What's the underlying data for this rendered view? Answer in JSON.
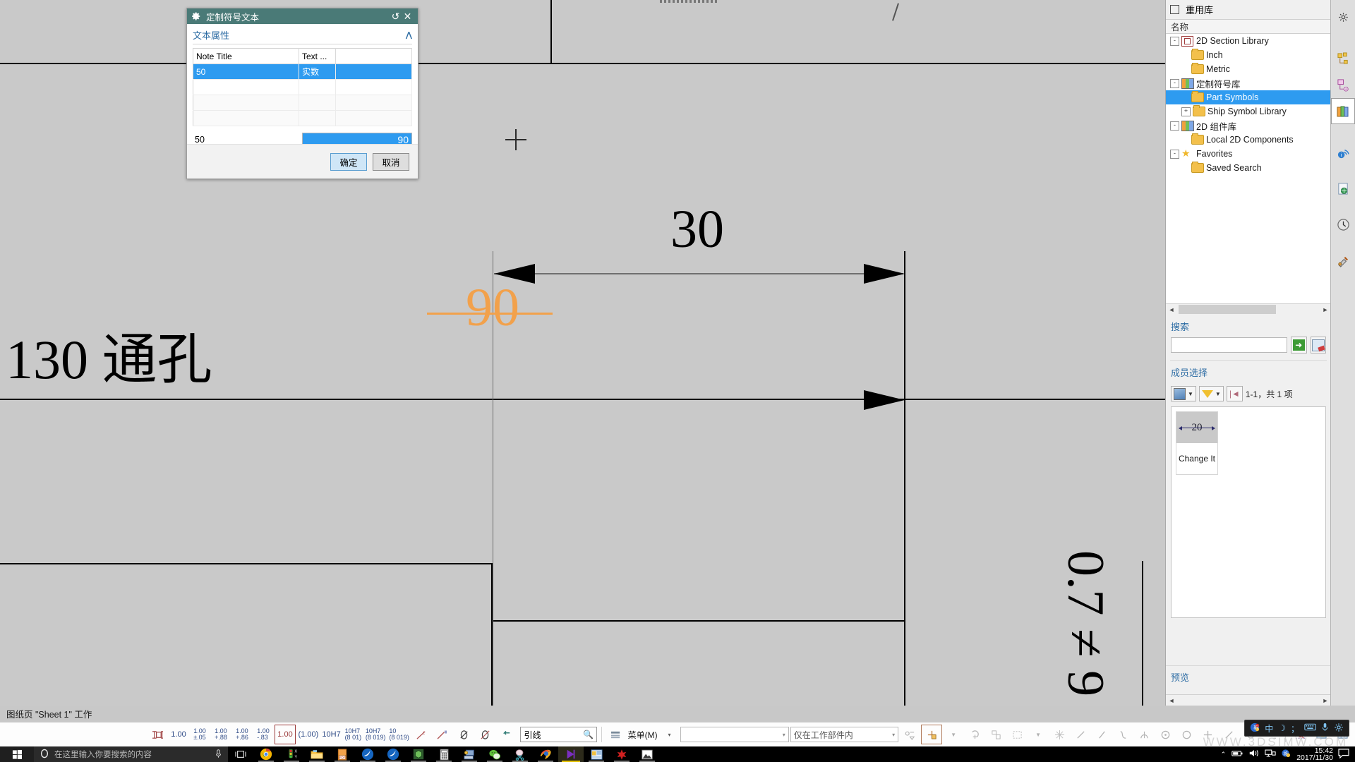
{
  "dialog": {
    "title": "定制符号文本",
    "gear_icon": "gear-icon",
    "reset_icon": "reset-icon",
    "close_icon": "close-icon",
    "section_title": "文本属性",
    "collapse_icon": "chevron-up-icon",
    "table": {
      "headers": [
        "Note Title",
        "Text ...",
        ""
      ],
      "rows": [
        {
          "note_title": "50",
          "text_type": "实数",
          "extra": "",
          "selected": true
        },
        {
          "note_title": "",
          "text_type": "",
          "extra": "",
          "selected": false
        },
        {
          "note_title": "",
          "text_type": "",
          "extra": "",
          "selected": false
        },
        {
          "note_title": "",
          "text_type": "",
          "extra": "",
          "selected": false
        }
      ]
    },
    "value_row": {
      "label": "50",
      "value": "90"
    },
    "ok_label": "确定",
    "cancel_label": "取消"
  },
  "canvas": {
    "dimension_30": "30",
    "orange_value": "90",
    "note_130": "130 通孔",
    "vertical_text": "0.7 ≠ 9",
    "crosshair": "crosshair-cursor"
  },
  "right_panel": {
    "title": "重用库",
    "title_icon": "panel-collapse-icon",
    "column_header": "名称",
    "tree": [
      {
        "label": "2D Section Library",
        "indent": 0,
        "expander": "-",
        "icon": "section-library-icon",
        "selected": false
      },
      {
        "label": "Inch",
        "indent": 1,
        "expander": "",
        "icon": "folder-icon",
        "selected": false
      },
      {
        "label": "Metric",
        "indent": 1,
        "expander": "",
        "icon": "folder-icon",
        "selected": false
      },
      {
        "label": "定制符号库",
        "indent": 0,
        "expander": "-",
        "icon": "books-icon",
        "selected": false
      },
      {
        "label": "Part Symbols",
        "indent": 1,
        "expander": "",
        "icon": "folder-icon",
        "selected": true
      },
      {
        "label": "Ship Symbol Library",
        "indent": 1,
        "expander": "+",
        "icon": "folder-icon",
        "selected": false
      },
      {
        "label": "2D 组件库",
        "indent": 0,
        "expander": "-",
        "icon": "books-icon",
        "selected": false
      },
      {
        "label": "Local 2D Components",
        "indent": 1,
        "expander": "",
        "icon": "folder-icon",
        "selected": false
      },
      {
        "label": "Favorites",
        "indent": 0,
        "expander": "-",
        "icon": "star-icon",
        "selected": false
      },
      {
        "label": "Saved Search",
        "indent": 1,
        "expander": "",
        "icon": "folder-icon",
        "selected": false
      }
    ],
    "search": {
      "title": "搜索",
      "value": "",
      "go_icon": "green-arrow-icon",
      "clear_icon": "erase-icon"
    },
    "member": {
      "title": "成员选择",
      "view_icon": "thumbnail-view-icon",
      "filter_icon": "filter-funnel-icon",
      "first_icon": "first-page-icon",
      "count_text": "1-1，共 1 项",
      "items": [
        {
          "thumb_value": "20",
          "name": "Change It"
        }
      ]
    },
    "preview_title": "预览",
    "scroll_left_icon": "chevron-left-icon",
    "scroll_right_icon": "chevron-right-icon"
  },
  "rail": [
    {
      "icon": "gear-icon",
      "name": "settings",
      "active": false
    },
    {
      "icon": "assembly-navigator-icon",
      "name": "assembly-navigator",
      "active": false
    },
    {
      "icon": "part-navigator-icon",
      "name": "part-navigator",
      "active": false
    },
    {
      "icon": "reuse-library-icon",
      "name": "reuse-library",
      "active": true
    },
    {
      "icon": "hd3d-icon",
      "name": "hd3d",
      "active": false
    },
    {
      "icon": "web-browser-icon",
      "name": "web-browser",
      "active": false
    },
    {
      "icon": "history-clock-icon",
      "name": "history",
      "active": false
    },
    {
      "icon": "process-tool-icon",
      "name": "process-studio",
      "active": false
    }
  ],
  "status_bar": {
    "message": "图纸页 \"Sheet 1\" 工作"
  },
  "bottom_toolbar": {
    "tolerance_icon": "tolerance-style-icon",
    "items": [
      "1.00",
      "1.00\n±.05",
      "1.00\n+.88",
      "1.00\n+.86",
      "1.00\n-.83",
      "1.00",
      "(1.00)",
      "10H7",
      "10H7\n(8 01)",
      "10H7\n(8 019)",
      "10\n(8 019)"
    ],
    "boxed_index": 5,
    "leader_field": {
      "value": "引线",
      "search_icon": "search-icon"
    },
    "menu": {
      "label": "菜单(M)",
      "icon": "menu-icon",
      "caret": "▾"
    },
    "combo1": {
      "value": "",
      "caret": "▾"
    },
    "combo2": {
      "value": "仅在工作部件内",
      "caret": "▾"
    },
    "draw_icons": [
      "select-filter-icon",
      "move-object-icon",
      "dropdown-caret-icon",
      "rotate-icon",
      "assembly-icon",
      "rectangle-select-icon",
      "caret-icon",
      "move-component-icon",
      "line-icon",
      "line-slant-icon",
      "spline-icon",
      "arc-icon",
      "circle-center-icon",
      "circle-icon",
      "plus-icon",
      "line-2-icon",
      "sketch-icon",
      "more-icon",
      "snap-icon",
      "highlight-icon",
      "grid-icon"
    ]
  },
  "taskbar": {
    "start_icon": "windows-start-icon",
    "search_placeholder": "在这里输入你要搜索的内容",
    "cortana_icon": "cortana-circle-icon",
    "mic_icon": "microphone-icon",
    "taskview_icon": "task-view-icon",
    "apps": [
      {
        "name": "chrome",
        "icon": "chrome-icon",
        "running": true,
        "current": false
      },
      {
        "name": "excel-addin",
        "icon": "traffic-xy-icon",
        "running": true,
        "current": false
      },
      {
        "name": "file-explorer",
        "icon": "folder-icon",
        "running": true,
        "current": false
      },
      {
        "name": "pdf-reader",
        "icon": "pdf-icon",
        "running": true,
        "current": false
      },
      {
        "name": "browser-blue",
        "icon": "blue-bird-icon",
        "running": true,
        "current": false
      },
      {
        "name": "browser-blue-2",
        "icon": "blue-bird-icon",
        "running": true,
        "current": false
      },
      {
        "name": "solid-modeler",
        "icon": "green-cube-icon",
        "running": true,
        "current": false
      },
      {
        "name": "calculator",
        "icon": "calculator-icon",
        "running": true,
        "current": false
      },
      {
        "name": "remote-desktop",
        "icon": "remote-pc-icon",
        "running": true,
        "current": false
      },
      {
        "name": "wechat",
        "icon": "wechat-icon",
        "running": true,
        "current": false
      },
      {
        "name": "snipping-tool",
        "icon": "scissors-icon",
        "running": true,
        "current": false
      },
      {
        "name": "ie-browser",
        "icon": "ie-swoosh-icon",
        "running": true,
        "current": false
      },
      {
        "name": "nx-drafting",
        "icon": "purple-play-icon",
        "running": true,
        "current": true
      },
      {
        "name": "office-doc",
        "icon": "office-icon",
        "running": true,
        "current": false
      },
      {
        "name": "red-app",
        "icon": "red-star-icon",
        "running": true,
        "current": false
      },
      {
        "name": "photo-viewer",
        "icon": "mountain-photo-icon",
        "running": true,
        "current": false
      }
    ],
    "tray": {
      "show_hidden_icon": "chevron-up-icon",
      "battery_icon": "battery-icon",
      "volume_icon": "volume-icon",
      "network_icon": "network-icon",
      "ime_tray_icon": "ime-icon",
      "time": "15:42",
      "date": "2017/11/30",
      "notification_icon": "action-center-icon"
    },
    "ime_bar": {
      "logo": "ime-logo-icon",
      "lang": "中",
      "mode": "moon-icon",
      "punct": "；",
      "keyboard_icon": "keyboard-icon",
      "mic_icon": "microphone-icon",
      "settings_icon": "gear-icon"
    }
  },
  "watermark": "WWW.3DSIMW.COM"
}
